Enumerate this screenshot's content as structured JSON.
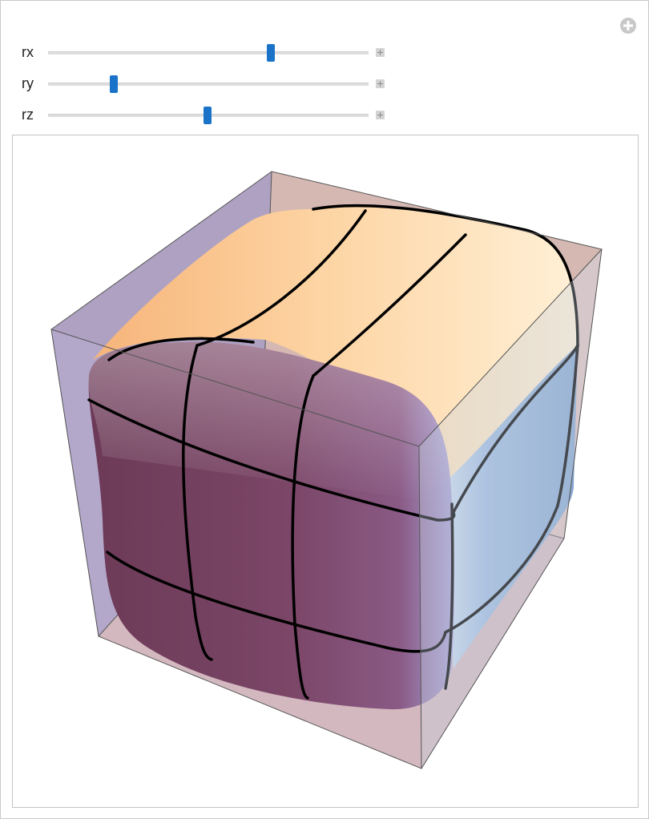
{
  "controls": {
    "sliders": [
      {
        "label": "rx",
        "value": 0.695
      },
      {
        "label": "ry",
        "value": 0.205
      },
      {
        "label": "rz",
        "value": 0.498
      }
    ]
  },
  "icons": {
    "add": "plus-circle-icon",
    "slider_expand": "plus-square-icon"
  },
  "colors": {
    "slider_thumb": "#1a73c9",
    "surface_top": "#fcd7a6",
    "surface_front": "#7a4668",
    "surface_side": "#8caad0"
  }
}
